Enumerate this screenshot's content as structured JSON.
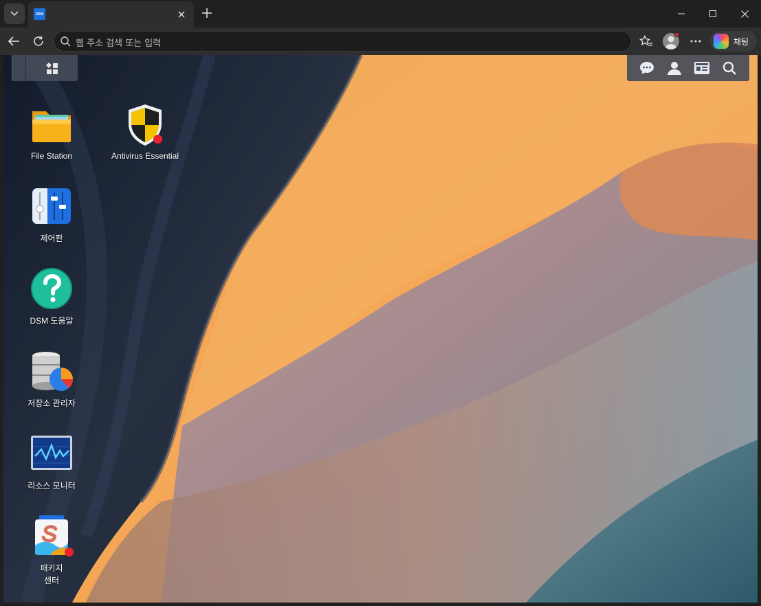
{
  "browser": {
    "favicon_text": "DSM",
    "address_placeholder": "웹 주소 검색 또는 입력",
    "chat_label": "채팅"
  },
  "desktop": {
    "apps": [
      {
        "id": "file-station",
        "label": "File Station"
      },
      {
        "id": "antivirus",
        "label": "Antivirus Essential"
      },
      {
        "id": "control-panel",
        "label": "제어판"
      },
      {
        "id": "dsm-help",
        "label": "DSM 도움말"
      },
      {
        "id": "storage-manager",
        "label": "저장소 관리자"
      },
      {
        "id": "resource-monitor",
        "label": "리소스 모니터"
      },
      {
        "id": "package-center",
        "label_line1": "패키지",
        "label_line2": "센터"
      }
    ]
  },
  "colors": {
    "badge": "#e9242f",
    "file_station_folder": "#f7b21b",
    "help_teal": "#1fbf9e"
  }
}
